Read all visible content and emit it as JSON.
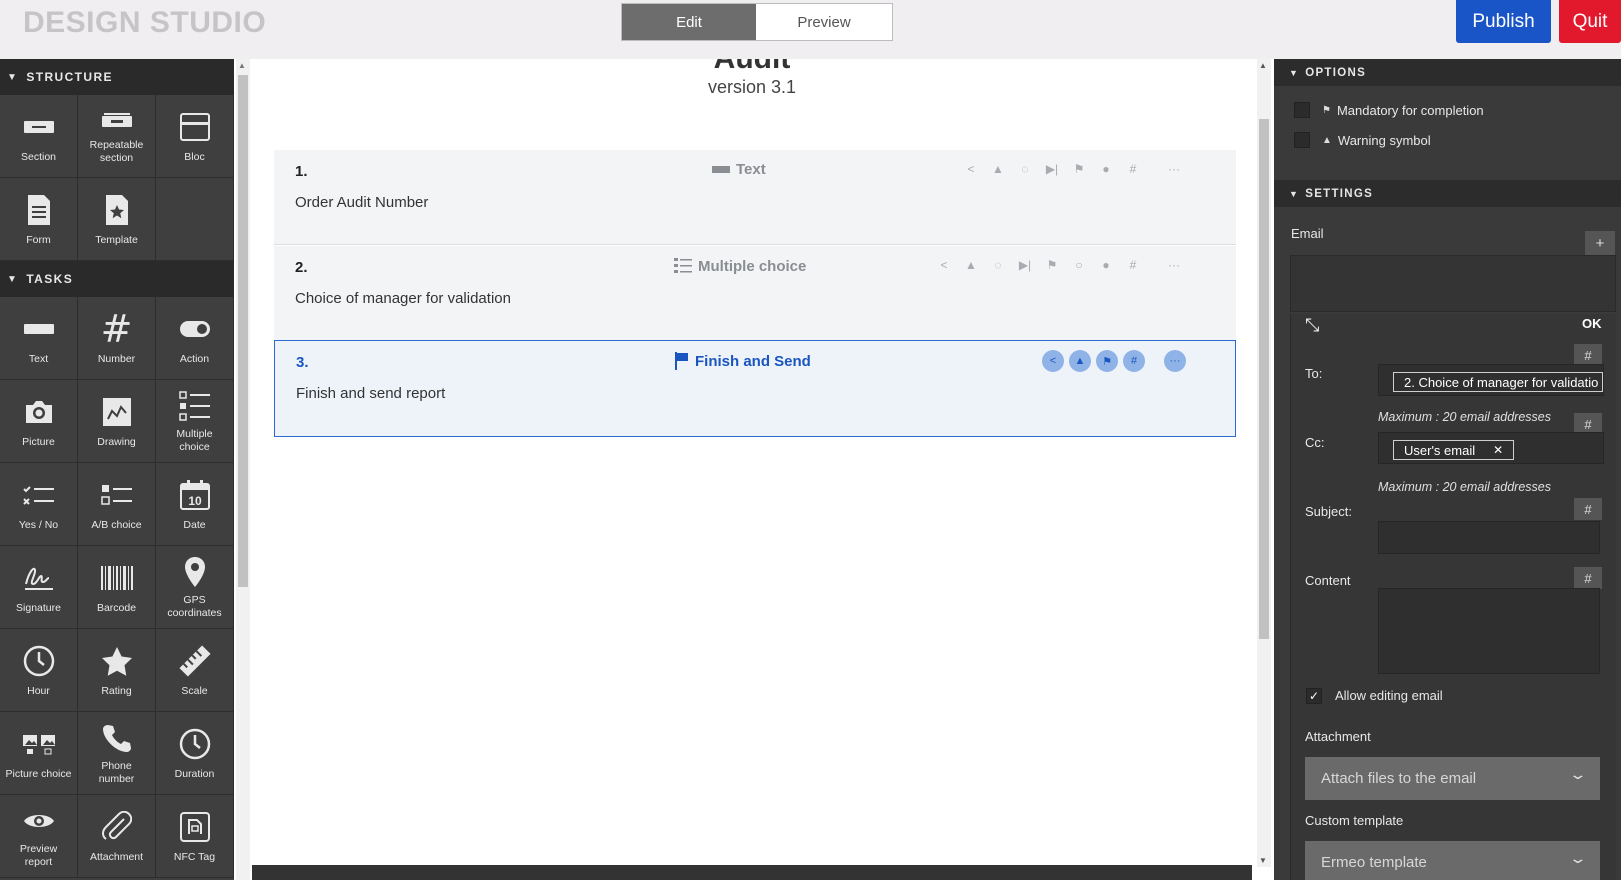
{
  "header": {
    "brand": "DESIGN STUDIO",
    "modes": [
      "Edit",
      "Preview"
    ],
    "active_mode": "Edit",
    "publish_label": "Publish",
    "quit_label": "Quit"
  },
  "palette": {
    "structure_title": "STRUCTURE",
    "structure_items": [
      {
        "label": "Section",
        "icon": "section-icon"
      },
      {
        "label": "Repeatable section",
        "icon": "repeatable-section-icon"
      },
      {
        "label": "Bloc",
        "icon": "bloc-icon"
      },
      {
        "label": "Form",
        "icon": "form-icon"
      },
      {
        "label": "Template",
        "icon": "template-icon"
      }
    ],
    "tasks_title": "TASKS",
    "task_items": [
      {
        "label": "Text",
        "icon": "text-field-icon"
      },
      {
        "label": "Number",
        "icon": "hash-icon"
      },
      {
        "label": "Action",
        "icon": "toggle-icon"
      },
      {
        "label": "Picture",
        "icon": "camera-icon"
      },
      {
        "label": "Drawing",
        "icon": "drawing-icon"
      },
      {
        "label": "Multiple choice",
        "icon": "checklist-icon"
      },
      {
        "label": "Yes / No",
        "icon": "yes-no-icon"
      },
      {
        "label": "A/B choice",
        "icon": "ab-choice-icon"
      },
      {
        "label": "Date",
        "icon": "calendar-icon"
      },
      {
        "label": "Signature",
        "icon": "signature-icon"
      },
      {
        "label": "Barcode",
        "icon": "barcode-icon"
      },
      {
        "label": "GPS coordinates",
        "icon": "map-pin-icon"
      },
      {
        "label": "Hour",
        "icon": "clock-icon"
      },
      {
        "label": "Rating",
        "icon": "star-icon"
      },
      {
        "label": "Scale",
        "icon": "ruler-icon"
      },
      {
        "label": "Picture choice",
        "icon": "picture-choice-icon"
      },
      {
        "label": "Phone number",
        "icon": "phone-icon"
      },
      {
        "label": "Duration",
        "icon": "duration-icon"
      },
      {
        "label": "Preview report",
        "icon": "eye-icon"
      },
      {
        "label": "Attachment",
        "icon": "paperclip-icon"
      },
      {
        "label": "NFC Tag",
        "icon": "nfc-icon"
      }
    ],
    "calendar_day": "10"
  },
  "document": {
    "title": "Audit",
    "version": "version 3.1",
    "questions": [
      {
        "number": "1.",
        "type": "Text",
        "text": "Order Audit Number"
      },
      {
        "number": "2.",
        "type": "Multiple choice",
        "text": "Choice of manager for validation"
      },
      {
        "number": "3.",
        "type": "Finish and Send",
        "text": "Finish and send report"
      }
    ],
    "more_label": "···"
  },
  "options": {
    "title": "OPTIONS",
    "mandatory_label": "Mandatory for completion",
    "warning_label": "Warning symbol"
  },
  "settings": {
    "title": "SETTINGS",
    "email_label": "Email",
    "plus_label": "+",
    "ok_label": "OK",
    "hash_label": "#",
    "to_label": "To:",
    "to_value": "2. Choice of manager for validatio",
    "to_hint": "Maximum : 20 email addresses",
    "cc_label": "Cc:",
    "cc_value": "User's email",
    "cc_remove": "✕",
    "cc_hint": "Maximum : 20 email addresses",
    "subject_label": "Subject:",
    "content_label": "Content",
    "allow_editing_label": "Allow editing email",
    "allow_editing_checked": "✓",
    "attachment_label": "Attachment",
    "attachment_select": "Attach files to the email",
    "custom_template_label": "Custom template",
    "template_select": "Ermeo template"
  }
}
